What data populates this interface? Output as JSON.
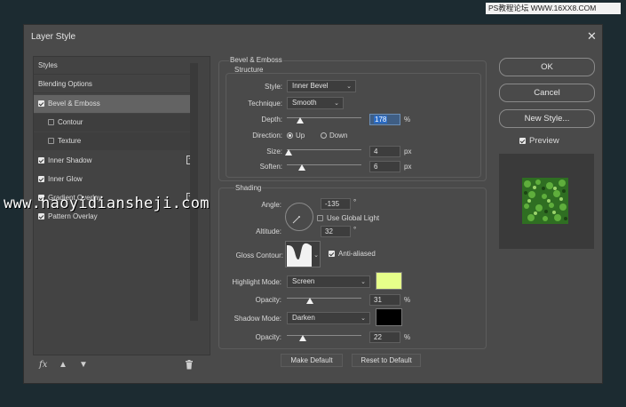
{
  "watermark_top": "PS教程论坛 WWW.16XX8.COM",
  "watermark_mid": "www.haoyidiansheji.com",
  "dialog": {
    "title": "Layer Style"
  },
  "styles_list": [
    {
      "label": "Styles",
      "checkbox": false
    },
    {
      "label": "Blending Options",
      "checkbox": false
    },
    {
      "label": "Bevel & Emboss",
      "checkbox": true,
      "checked": true,
      "selected": true
    },
    {
      "label": "Contour",
      "checkbox": true,
      "checked": false,
      "sub": true
    },
    {
      "label": "Texture",
      "checkbox": true,
      "checked": false,
      "sub": true
    },
    {
      "label": "Inner Shadow",
      "checkbox": true,
      "checked": true,
      "plus": true
    },
    {
      "label": "Inner Glow",
      "checkbox": true,
      "checked": true
    },
    {
      "label": "Gradient Overlay",
      "checkbox": true,
      "checked": true,
      "plus": true
    },
    {
      "label": "Pattern Overlay",
      "checkbox": true,
      "checked": true
    }
  ],
  "bottom_icons": [
    "fx-icon",
    "arrow-up-icon",
    "arrow-down-icon",
    "trash-icon"
  ],
  "bevel": {
    "group_title": "Bevel & Emboss",
    "structure_title": "Structure",
    "style_label": "Style:",
    "style_value": "Inner Bevel",
    "technique_label": "Technique:",
    "technique_value": "Smooth",
    "depth_label": "Depth:",
    "depth_value": "178",
    "depth_unit": "%",
    "direction_label": "Direction:",
    "direction_up": "Up",
    "direction_down": "Down",
    "direction_selected": "Up",
    "size_label": "Size:",
    "size_value": "4",
    "size_unit": "px",
    "soften_label": "Soften:",
    "soften_value": "6",
    "soften_unit": "px"
  },
  "shading": {
    "title": "Shading",
    "angle_label": "Angle:",
    "angle_value": "-135",
    "angle_unit": "°",
    "global_light_label": "Use Global Light",
    "global_light_checked": false,
    "altitude_label": "Altitude:",
    "altitude_value": "32",
    "altitude_unit": "°",
    "gloss_label": "Gloss Contour:",
    "anti_aliased_label": "Anti-aliased",
    "anti_aliased_checked": true,
    "highlight_label": "Highlight Mode:",
    "highlight_value": "Screen",
    "highlight_color": "#e6ff8a",
    "highlight_opacity_label": "Opacity:",
    "highlight_opacity_value": "31",
    "highlight_opacity_unit": "%",
    "shadow_label": "Shadow Mode:",
    "shadow_value": "Darken",
    "shadow_color": "#000000",
    "shadow_opacity_label": "Opacity:",
    "shadow_opacity_value": "22",
    "shadow_opacity_unit": "%"
  },
  "slider_levels": {
    "depth": 0.178,
    "size": 0.02,
    "soften": 0.2,
    "highlight_opacity": 0.31,
    "shadow_opacity": 0.22
  },
  "make_default_label": "Make Default",
  "reset_default_label": "Reset to Default",
  "buttons": {
    "ok": "OK",
    "cancel": "Cancel",
    "new_style": "New Style..."
  },
  "preview": {
    "label": "Preview",
    "checked": true,
    "texture_color": "#3f8a2e"
  }
}
